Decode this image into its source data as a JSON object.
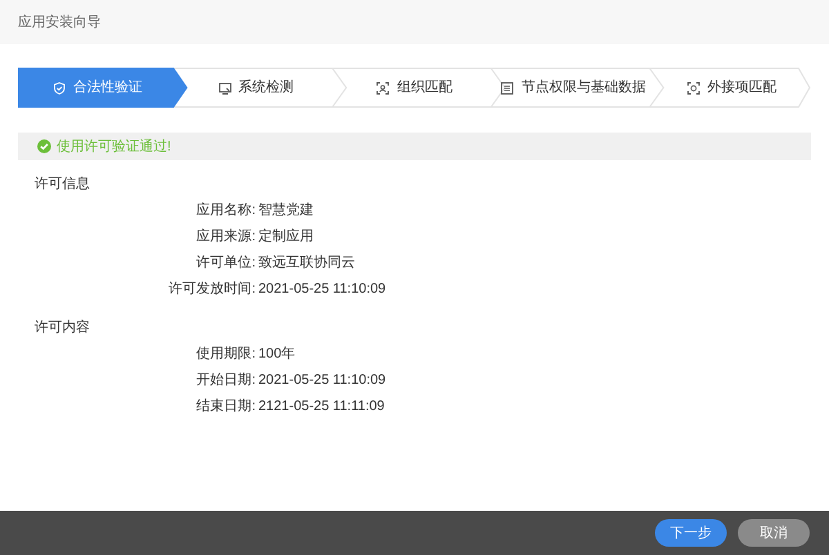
{
  "window": {
    "title": "应用安装向导"
  },
  "steps": [
    {
      "label": "合法性验证",
      "kind": "shield",
      "selected": true
    },
    {
      "label": "系统检测",
      "kind": "monitor",
      "selected": false
    },
    {
      "label": "组织匹配",
      "kind": "scan",
      "selected": false
    },
    {
      "label": "节点权限与基础数据",
      "kind": "list",
      "selected": false
    },
    {
      "label": "外接项匹配",
      "kind": "target",
      "selected": false
    }
  ],
  "alert": {
    "text": "使用许可验证通过!"
  },
  "sections": [
    {
      "title": "许可信息",
      "fields": [
        {
          "label": "应用名称:",
          "value": "智慧党建"
        },
        {
          "label": "应用来源:",
          "value": "定制应用"
        },
        {
          "label": "许可单位:",
          "value": "致远互联协同云"
        },
        {
          "label": "许可发放时间:",
          "value": "2021-05-25 11:10:09"
        }
      ]
    },
    {
      "title": "许可内容",
      "fields": [
        {
          "label": "使用期限:",
          "value": "100年"
        },
        {
          "label": "开始日期:",
          "value": "2021-05-25 11:10:09"
        },
        {
          "label": "结束日期:",
          "value": "2121-05-25 11:11:09"
        }
      ]
    }
  ],
  "footer": {
    "buttons": [
      {
        "label": "下一步",
        "kind": "primary"
      },
      {
        "label": "取消",
        "kind": "secondary"
      }
    ]
  }
}
